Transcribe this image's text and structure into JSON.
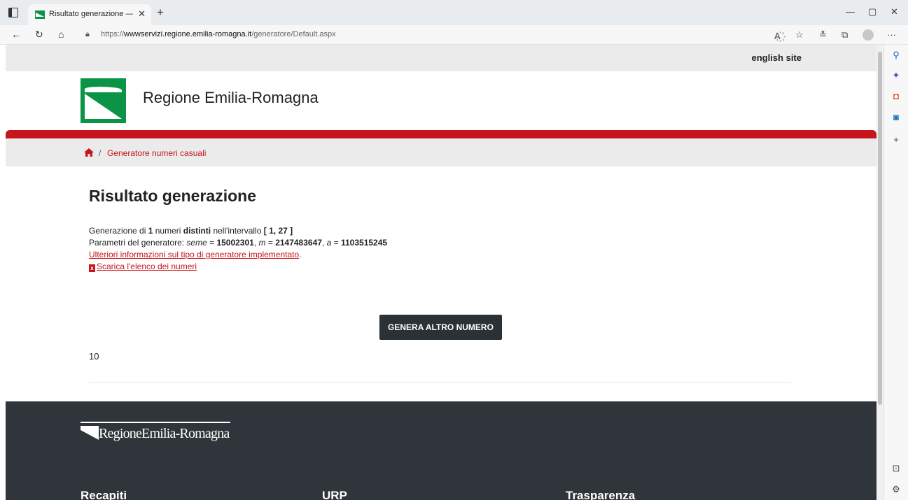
{
  "browser": {
    "tab_title": "Risultato generazione — E-R Il por",
    "url_scheme": "https://",
    "url_host": "wwwservizi.regione.emilia-romagna.it",
    "url_path": "/generatore/Default.aspx"
  },
  "page": {
    "english_link": "english site",
    "site_name": "Regione Emilia-Romagna",
    "breadcrumb_sep": "/",
    "breadcrumb_current": "Generatore numeri casuali",
    "title": "Risultato generazione",
    "gen_line": {
      "t1": "Generazione di ",
      "count": "1",
      "t2": " numeri ",
      "distinct": "distinti",
      "t3": " nell'intervallo ",
      "range": "[ 1, 27 ]"
    },
    "params_line": {
      "t1": "Parametri del generatore: ",
      "seed_label": "seme",
      "eq": " = ",
      "seed": "15002301",
      "sep1": ", ",
      "m_label": "m",
      "m": "2147483647",
      "a_label": "a",
      "a": "1103515245"
    },
    "more_info_link": "Ulteriori informazioni sul tipo di generatore implementato",
    "more_info_suffix": ".",
    "download_link": "Scarica l'elenco dei numeri",
    "generate_button": "GENERA ALTRO NUMERO",
    "result": "10"
  },
  "footer": {
    "logo_text": "RegioneEmilia-Romagna",
    "columns": [
      "Recapiti",
      "URP",
      "Trasparenza"
    ]
  }
}
